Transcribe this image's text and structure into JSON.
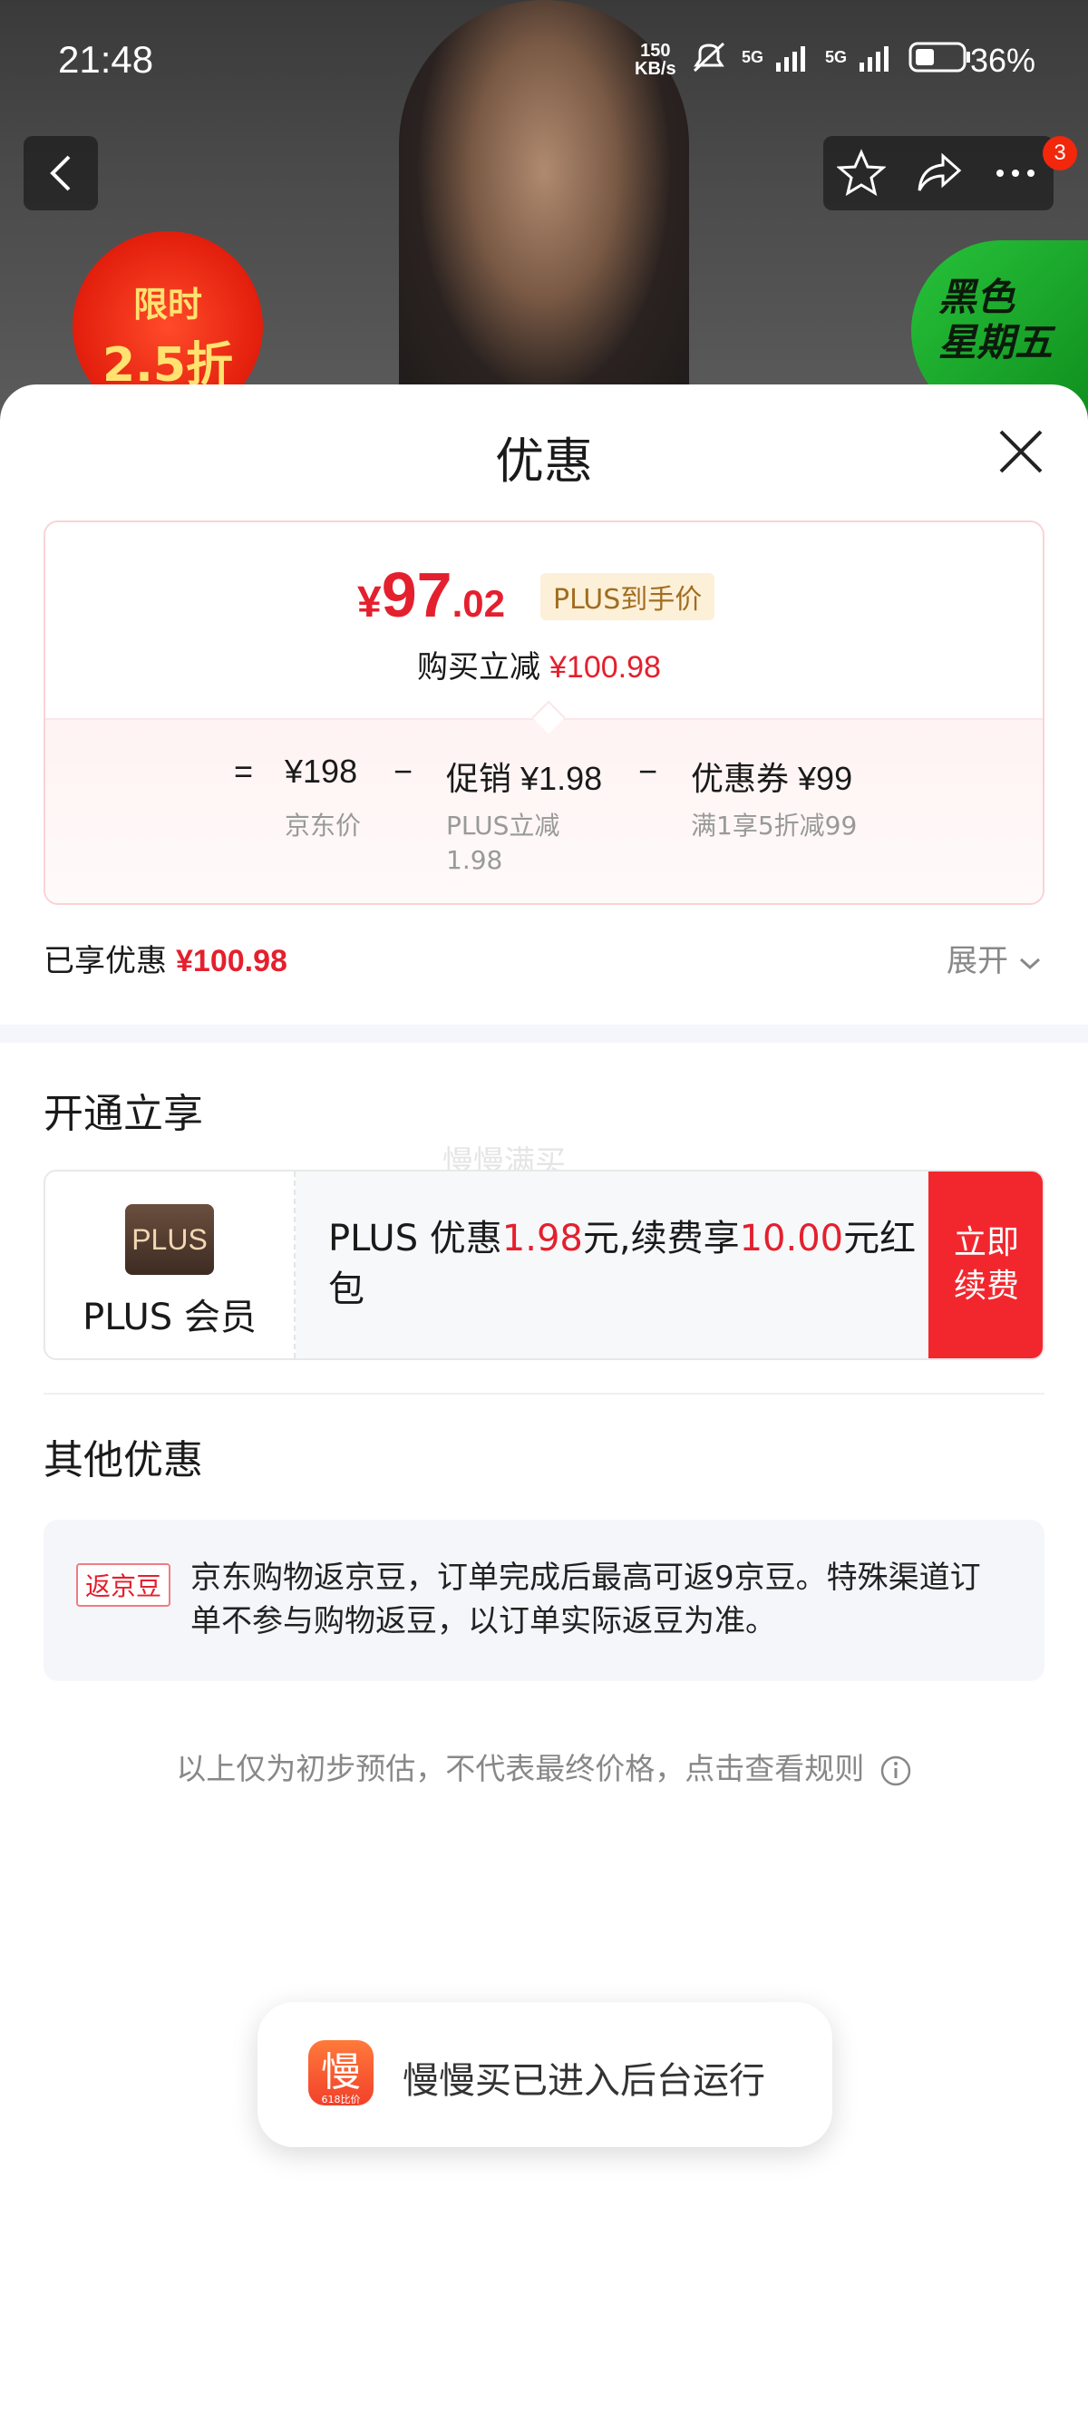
{
  "status": {
    "time": "21:48",
    "net_speed_value": "150",
    "net_speed_unit": "KB/s",
    "net1": "5G",
    "net2": "5G",
    "battery": "36%"
  },
  "hero": {
    "badge_count": "3",
    "promo_left_line1": "限时",
    "promo_left_line2": "2.5折",
    "promo_right_line1": "黑色",
    "promo_right_line2": "星期五"
  },
  "sheet": {
    "title": "优惠",
    "price": {
      "symbol": "¥",
      "integer": "97",
      "decimal": ".02",
      "tag": "PLUS到手价",
      "reduce_label": "购买立减",
      "reduce_amount": "¥100.98"
    },
    "breakdown": {
      "eq": "=",
      "base_value": "¥198",
      "base_label": "京东价",
      "minus1": "−",
      "promo_label_inline": "促销",
      "promo_value": "¥1.98",
      "promo_sub_line1": "PLUS立减",
      "promo_sub_line2": "1.98",
      "minus2": "−",
      "coupon_label_inline": "优惠券",
      "coupon_value": "¥99",
      "coupon_sub": "满1享5折减99"
    },
    "enjoyed_label": "已享优惠",
    "enjoyed_amount": "¥100.98",
    "expand_label": "展开"
  },
  "open_section": {
    "title": "开通立享",
    "watermark": "慢慢满买",
    "plus_logo": "PLUS",
    "plus_name": "PLUS 会员",
    "desc_part1": "PLUS 优惠",
    "desc_value1": "1.98",
    "desc_part2": "元,续费享",
    "desc_value2": "10.00",
    "desc_part3": "元红包",
    "button_line1": "立即",
    "button_line2": "续费"
  },
  "other_section": {
    "title": "其他优惠",
    "tag": "返京豆",
    "text": "京东购物返京豆，订单完成后最高可返9京豆。特殊渠道订单不参与购物返豆，以订单实际返豆为准。"
  },
  "note": "以上仅为初步预估，不代表最终价格，点击查看规则",
  "toast": {
    "icon_char": "慢",
    "icon_sub": "618比价",
    "text": "慢慢买已进入后台运行"
  },
  "colors": {
    "accent_red": "#e4202e",
    "plus_tag_bg": "#fdf0d8",
    "renew_button": "#f2272e"
  }
}
